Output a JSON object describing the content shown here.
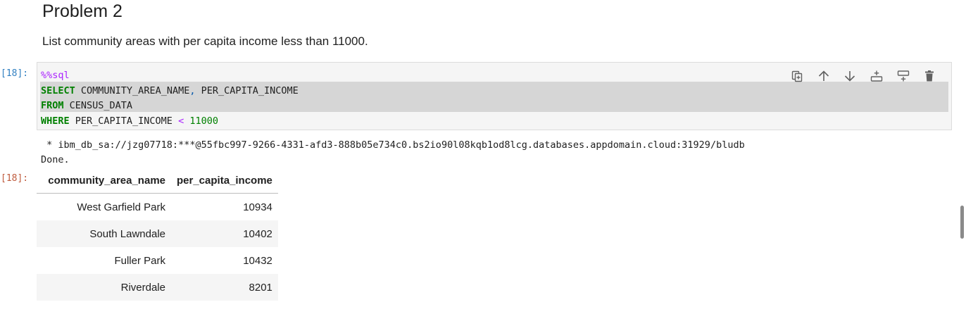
{
  "markdown": {
    "heading": "Problem 2",
    "text": "List community areas with per capita income less than 11000."
  },
  "code_cell": {
    "prompt": "[18]:",
    "lines": {
      "magic": "%%sql",
      "l1_kw": "SELECT",
      "l1_rest_a": " COMMUNITY_AREA_NAME",
      "l1_comma": ",",
      "l1_rest_b": " PER_CAPITA_INCOME",
      "l2_kw": "FROM",
      "l2_rest": " CENSUS_DATA",
      "l3_kw": "WHERE",
      "l3_rest": " PER_CAPITA_INCOME ",
      "l3_op": "<",
      "l3_num": " 11000"
    },
    "toolbar": [
      {
        "name": "duplicate-cell-icon",
        "title": "Duplicate cell"
      },
      {
        "name": "move-up-icon",
        "title": "Move up"
      },
      {
        "name": "move-down-icon",
        "title": "Move down"
      },
      {
        "name": "insert-cell-above-icon",
        "title": "Insert cell above"
      },
      {
        "name": "insert-cell-below-icon",
        "title": "Insert cell below"
      },
      {
        "name": "delete-cell-icon",
        "title": "Delete cell"
      }
    ]
  },
  "output": {
    "prompt": "[18]:",
    "connection": " * ibm_db_sa://jzg07718:***@55fbc997-9266-4331-afd3-888b05e734c0.bs2io90l08kqb1od8lcg.databases.appdomain.cloud:31929/bludb",
    "status": "Done.",
    "table": {
      "headers": [
        "community_area_name",
        "per_capita_income"
      ],
      "rows": [
        [
          "West Garfield Park",
          "10934"
        ],
        [
          "South Lawndale",
          "10402"
        ],
        [
          "Fuller Park",
          "10432"
        ],
        [
          "Riverdale",
          "8201"
        ]
      ]
    }
  },
  "colors": {
    "keyword": "#008000",
    "magic": "#aa22ff",
    "in_prompt": "#307fc1",
    "out_prompt": "#bf5b3d"
  }
}
